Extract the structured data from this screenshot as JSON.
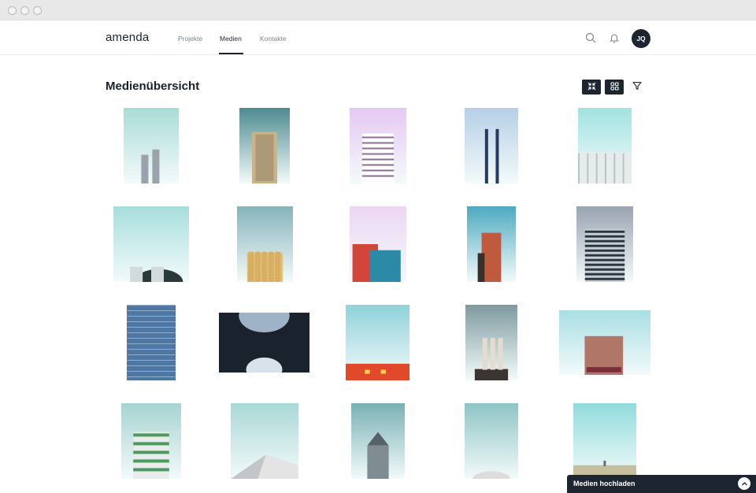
{
  "app": {
    "brand": "amenda"
  },
  "nav": {
    "items": [
      {
        "label": "Projekte",
        "active": false
      },
      {
        "label": "Medien",
        "active": true
      },
      {
        "label": "Kontakte",
        "active": false
      }
    ]
  },
  "header": {
    "icons": [
      "search-icon",
      "bell-icon"
    ],
    "avatar_initials": "JQ"
  },
  "page": {
    "title": "Medienübersicht"
  },
  "toolbar": {
    "buttons": [
      "collapse-view-icon",
      "grid-view-icon",
      "filter-icon"
    ]
  },
  "media": {
    "items": [
      {
        "name": "twin-towers-mint",
        "colors": {
          "sky": "#a9dcd7",
          "building": "#9aa3a9"
        }
      },
      {
        "name": "tall-tower-teal",
        "colors": {
          "sky": "#4d8b90",
          "building": "#c9b48a"
        }
      },
      {
        "name": "block-pink-sky",
        "colors": {
          "sky": "#e6c8f3",
          "building": "#ffffff"
        }
      },
      {
        "name": "chimneys-blue",
        "colors": {
          "sky": "#b6cfe6",
          "building": "#263b5c"
        }
      },
      {
        "name": "white-lattice-mint",
        "colors": {
          "sky": "#a3e2e2",
          "building": "#e6ecec"
        }
      },
      {
        "name": "domes-mint",
        "colors": {
          "sky": "#a8dedd",
          "building": "#d3dadb"
        }
      },
      {
        "name": "silos-yellow",
        "colors": {
          "sky": "#86b3bb",
          "building": "#e2c07c"
        }
      },
      {
        "name": "red-blue-block",
        "colors": {
          "sky": "#ecd7f3",
          "building": "#2d8aa6"
        }
      },
      {
        "name": "red-tower-teal",
        "colors": {
          "sky": "#4eaac1",
          "building": "#c05a3e"
        }
      },
      {
        "name": "dark-stripes-grey",
        "colors": {
          "sky": "#9aa4b2",
          "building": "#2d3540"
        }
      },
      {
        "name": "glass-curve-blue",
        "colors": {
          "sky": "#d5e7f2",
          "building": "#4f77a4"
        }
      },
      {
        "name": "dark-arch-sky",
        "colors": {
          "sky": "#5e7698",
          "building": "#1a222d"
        }
      },
      {
        "name": "red-roof-aqua",
        "colors": {
          "sky": "#8fd2da",
          "building": "#e04a2a"
        }
      },
      {
        "name": "power-station",
        "colors": {
          "sky": "#7e9aa0",
          "building": "#3a3533"
        }
      },
      {
        "name": "victorian-corner",
        "colors": {
          "sky": "#a8dee2",
          "building": "#b07667"
        }
      },
      {
        "name": "green-tower",
        "colors": {
          "sky": "#a6d4d1",
          "building": "#4d9a61"
        }
      },
      {
        "name": "white-roof-mint",
        "colors": {
          "sky": "#a9d8d6",
          "building": "#e4e4e4"
        }
      },
      {
        "name": "pencil-tower",
        "colors": {
          "sky": "#79b1b4",
          "building": "#7f8d92"
        }
      },
      {
        "name": "mint-sky-dome",
        "colors": {
          "sky": "#8fc4c5",
          "building": "#dddddd"
        }
      },
      {
        "name": "roofline-aqua",
        "colors": {
          "sky": "#91dbdc",
          "building": "#c4bf9e"
        }
      }
    ]
  },
  "upload": {
    "label": "Medien hochladen",
    "icon": "chevron-up-icon"
  }
}
